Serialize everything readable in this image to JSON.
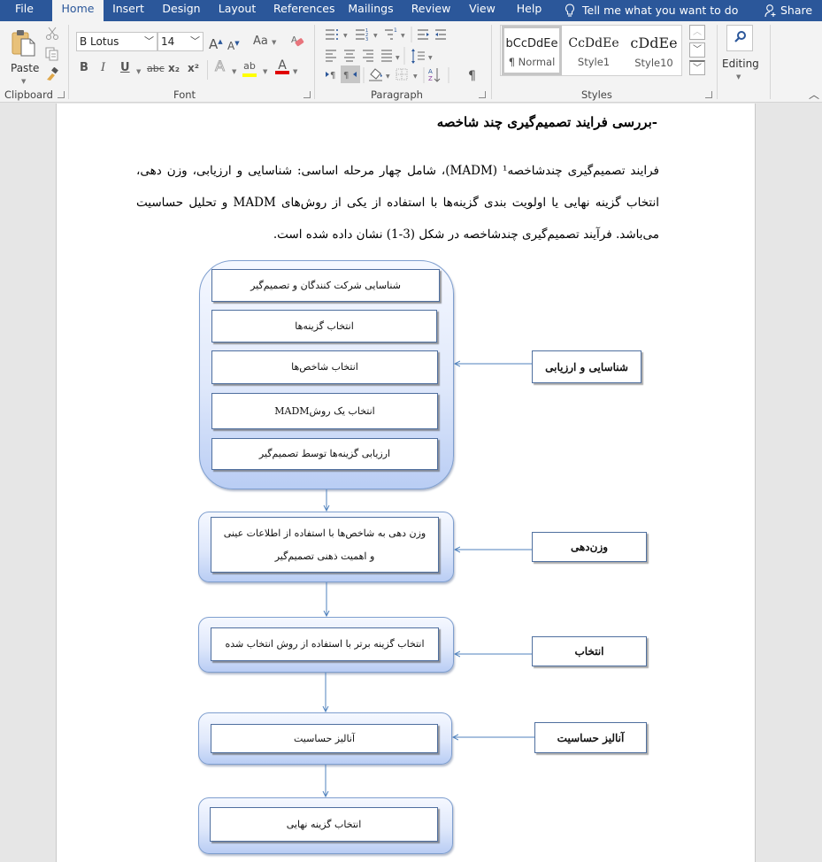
{
  "tabs": [
    {
      "label": "File",
      "active": false
    },
    {
      "label": "Home",
      "active": true
    },
    {
      "label": "Insert",
      "active": false
    },
    {
      "label": "Design",
      "active": false
    },
    {
      "label": "Layout",
      "active": false
    },
    {
      "label": "References",
      "active": false
    },
    {
      "label": "Mailings",
      "active": false
    },
    {
      "label": "Review",
      "active": false
    },
    {
      "label": "View",
      "active": false
    },
    {
      "label": "Help",
      "active": false
    }
  ],
  "tell_me": {
    "icon": "lightbulb-icon",
    "label": "Tell me what you want to do"
  },
  "share": {
    "icon": "person-add-icon",
    "label": "Share"
  },
  "ribbon": {
    "clipboard": {
      "label": "Clipboard",
      "paste_label": "Paste",
      "icons": [
        "paste-icon",
        "cut-icon",
        "copy-icon",
        "format-painter-icon"
      ]
    },
    "font": {
      "label": "Font",
      "font_name": "B Lotus",
      "font_size": "14",
      "buttons": {
        "grow": "A",
        "shrink": "A",
        "change_case": "Aa",
        "bold": "B",
        "italic": "I",
        "underline": "U",
        "strikethrough": "abc",
        "subscript": "x₂",
        "superscript": "x²",
        "text_effects": "A",
        "highlight": "ab",
        "font_color": "A"
      },
      "highlight_color": "#ffff00",
      "font_color": "#e00000"
    },
    "paragraph": {
      "label": "Paragraph",
      "pilcrow": "¶"
    },
    "styles": {
      "label": "Styles",
      "items": [
        {
          "preview": "bCcDdEe",
          "name": "¶ Normal",
          "selected": true
        },
        {
          "preview": "CcDdEe",
          "name": "Style1",
          "selected": false
        },
        {
          "preview": "cDdEe",
          "name": "Style10",
          "selected": false
        }
      ]
    },
    "editing": {
      "label": "Editing",
      "icon": "search-icon"
    }
  },
  "document": {
    "heading": "-بررسی فرایند تصمیم‌گیری چند شاخصه",
    "paragraph": "فرایند تصمیم‌گیری چندشاخصه¹ (MADM)، شامل چهار مرحله اساسی: شناسایی و ارزیابی، وزن دهی، انتخاب گزینه نهایی یا اولویت بندی گزینه‌ها با استفاده از یکی از روش‌های MADM و تحلیل حساسیت می‌باشد. فرآیند تصمیم‌گیری چندشاخصه در شکل (3-1) نشان داده شده است."
  },
  "flowchart": {
    "stage1_steps": [
      "شناسایی شرکت کنندگان و تصمیم‌گیر",
      "انتخاب گزینه‌ها",
      "انتخاب شاخص‌ها",
      "انتخاب یک روشMADM",
      "ارزیابی گزینه‌ها توسط تصمیم‌گیر"
    ],
    "stage2_step": "وزن دهی به شاخص‌ها با استفاده از اطلاعات عینی و اهمیت ذهنی تصمیم‌گیر",
    "stage3_step": "انتخاب گزینه برتر با استفاده از روش انتخاب شده",
    "stage4_step": "آنالیز حساسیت",
    "stage5_step": "انتخاب گزینه نهایی",
    "side_labels": [
      "شناسایی و ارزیابی",
      "وزن‌دهی",
      "انتخاب",
      "آنالیز حساسیت"
    ]
  }
}
